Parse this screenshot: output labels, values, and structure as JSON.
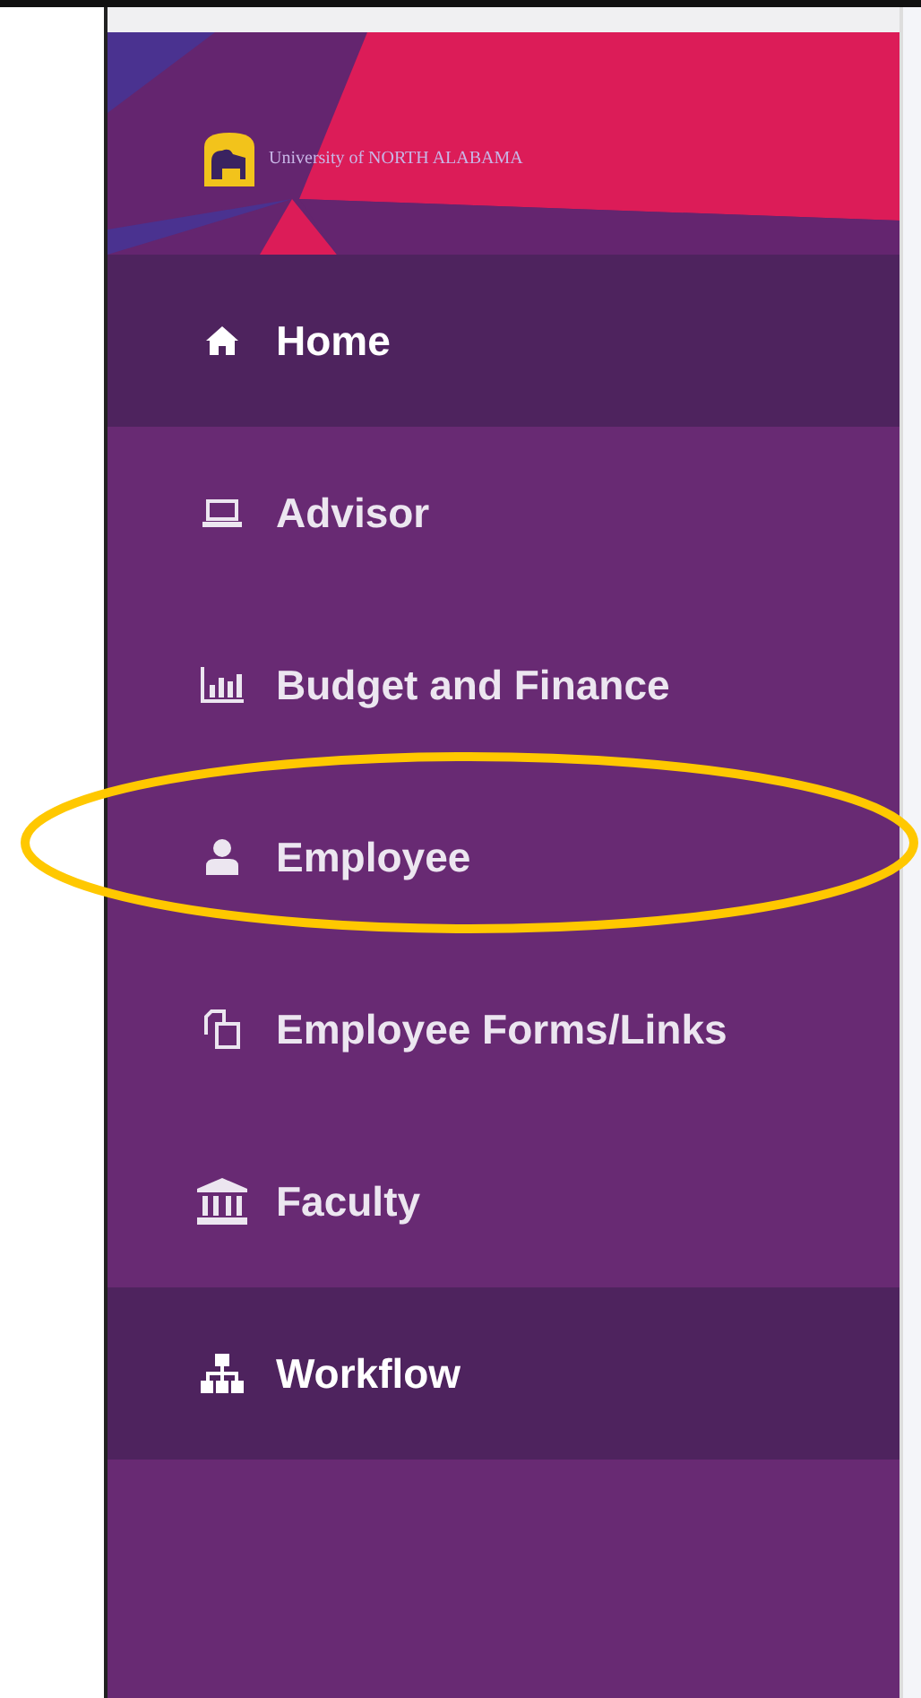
{
  "header": {
    "logo_text": "University of NORTH ALABAMA"
  },
  "menu": [
    {
      "label": "Home",
      "selected": true,
      "circled": false
    },
    {
      "label": "Advisor",
      "selected": false,
      "circled": false
    },
    {
      "label": "Budget and Finance",
      "selected": false,
      "circled": false
    },
    {
      "label": "Employee",
      "selected": false,
      "circled": true
    },
    {
      "label": "Employee Forms/Links",
      "selected": false,
      "circled": false
    },
    {
      "label": "Faculty",
      "selected": false,
      "circled": false
    },
    {
      "label": "Workflow",
      "selected": true,
      "circled": false
    }
  ]
}
